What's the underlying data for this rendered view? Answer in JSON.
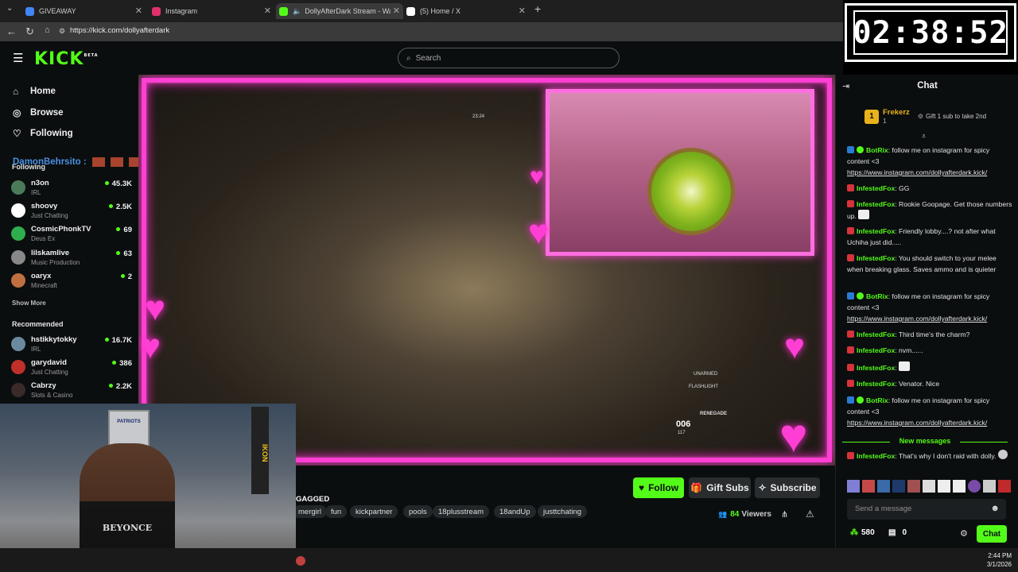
{
  "browser": {
    "tabs": [
      {
        "label": "GIVEAWAY",
        "color": "#4285f4"
      },
      {
        "label": "Instagram",
        "color": "#e1306c"
      },
      {
        "label": "DollyAfterDark Stream - Watc",
        "color": "#53fc18"
      },
      {
        "label": "(5) Home / X",
        "color": "#ffffff"
      }
    ],
    "url": "https://kick.com/dollyafterdark"
  },
  "timer": {
    "value": "02:38:52"
  },
  "kick": {
    "logo": "KICK",
    "logo_sup": "BETA",
    "search_placeholder": "Search"
  },
  "sidebar": {
    "nav": [
      {
        "label": "Home",
        "icon": "home-icon"
      },
      {
        "label": "Browse",
        "icon": "compass-icon"
      },
      {
        "label": "Following",
        "icon": "heart-icon"
      }
    ],
    "following_title": "Following",
    "following": [
      {
        "name": "n3on",
        "category": "IRL",
        "viewers": "45.3K",
        "color": "#4a7a5a"
      },
      {
        "name": "shoovy",
        "category": "Just Chatting",
        "viewers": "2.5K",
        "color": "#ffffff"
      },
      {
        "name": "CosmicPhonkTV",
        "category": "Deus Ex",
        "viewers": "69",
        "color": "#2fae4e"
      },
      {
        "name": "lilskamlive",
        "category": "Music Production",
        "viewers": "63",
        "color": "#888888"
      },
      {
        "name": "oaryx",
        "category": "Minecraft",
        "viewers": "2",
        "color": "#c07040"
      }
    ],
    "show_more": "Show More",
    "recommended_title": "Recommended",
    "recommended": [
      {
        "name": "hstikkytokky",
        "category": "IRL",
        "viewers": "16.7K",
        "color": "#6a8aa0"
      },
      {
        "name": "garydavid",
        "category": "Just Chatting",
        "viewers": "386",
        "color": "#c0302a"
      },
      {
        "name": "Cabrzy",
        "category": "Slots & Casino",
        "viewers": "2.2K",
        "color": "#3a2a2a"
      }
    ],
    "overlay_username": "DamonBehrsito :"
  },
  "video": {
    "hud_time": "23:24",
    "hud_unarmed": "UNARMED",
    "hud_flashlight": "FLASHLIGHT",
    "hud_weapon": "RENEGADE",
    "hud_ammo": "006",
    "hud_ammo_reserve": "117"
  },
  "stream_info": {
    "title_fragment": "GAGGED",
    "follow": "Follow",
    "gift_subs": "Gift Subs",
    "subscribe": "Subscribe",
    "viewers": "84",
    "viewers_label": "Viewers",
    "tags": [
      "mergirl",
      "fun",
      "kickpartner",
      "pools",
      "18plusstream",
      "18andUp",
      "justtchating"
    ]
  },
  "chat": {
    "title": "Chat",
    "pinned_user": "Frekerz",
    "pinned_rank": "1",
    "pinned_count": "1",
    "pinned_text": "Gift 1 sub to take 2nd",
    "messages": [
      {
        "user": "BotRix",
        "color": "#53fc18",
        "text": "follow me on instagram for spicy content <3",
        "link": "https://www.instagram.com/dollyafterdark.kick/"
      },
      {
        "user": "InfestedFox",
        "color": "#53fc18",
        "text": "GG",
        "link": ""
      },
      {
        "user": "InfestedFox",
        "color": "#53fc18",
        "text": "Rookie Goopage. Get those numbers up.",
        "link": ""
      },
      {
        "user": "InfestedFox",
        "color": "#53fc18",
        "text": "Friendly lobby....? not after what Uchiha just did.....",
        "link": ""
      },
      {
        "user": "InfestedFox",
        "color": "#53fc18",
        "text": "You should switch to your melee when breaking glass. Saves ammo and is quieter",
        "link": ""
      },
      {
        "user": "BotRix",
        "color": "#53fc18",
        "text": "follow me on instagram for spicy content <3",
        "link": "https://www.instagram.com/dollyafterdark.kick/"
      },
      {
        "user": "InfestedFox",
        "color": "#53fc18",
        "text": "Third time's the charm?",
        "link": ""
      },
      {
        "user": "InfestedFox",
        "color": "#53fc18",
        "text": "nvm......",
        "link": ""
      },
      {
        "user": "InfestedFox",
        "color": "#53fc18",
        "text": "",
        "link": ""
      },
      {
        "user": "InfestedFox",
        "color": "#53fc18",
        "text": "Venator. Nice",
        "link": ""
      },
      {
        "user": "BotRix",
        "color": "#53fc18",
        "text": "follow me on instagram for spicy content <3",
        "link": "https://www.instagram.com/dollyafterdark.kick/"
      }
    ],
    "new_messages": "New messages",
    "last_message": {
      "user": "InfestedFox",
      "text": "That's why I don't raid with dolly."
    },
    "send_placeholder": "Send a message",
    "points": "580",
    "gifts": "0",
    "chat_button": "Chat"
  },
  "taskbar": {
    "time": "2:44 PM",
    "date": "3/1/2026"
  },
  "webcam": {
    "shirt_text": "BEYONCE",
    "poster_text": "PATRIOTS",
    "sign_text": "IKON"
  }
}
